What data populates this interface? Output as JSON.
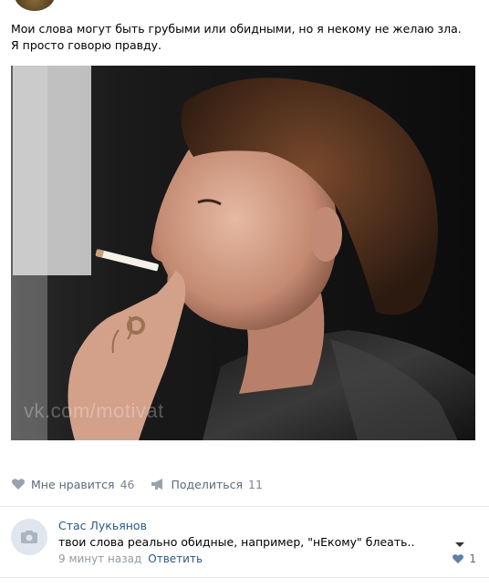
{
  "post": {
    "text": "Мои слова могут быть грубыми или обидными, но я некому не желаю зла. Я просто говорю правду.",
    "image_watermark": "vk.com/motivat"
  },
  "actions": {
    "like_label": "Мне нравится",
    "like_count": "46",
    "share_label": "Поделиться",
    "share_count": "11"
  },
  "comment": {
    "author": "Стас Лукьянов",
    "text": "твои слова реально обидные, например, \"нЕкому\" блеать..",
    "time": "9 минут назад",
    "reply_label": "Ответить",
    "like_count": "1"
  },
  "icons": {
    "like": "heart-icon",
    "share": "megaphone-icon",
    "avatar_placeholder": "camera-icon",
    "comment_like": "heart-icon",
    "comment_menu": "chevron-down-icon"
  },
  "colors": {
    "link": "#2a5885",
    "muted": "#939aa3",
    "icon": "#99a2ad"
  }
}
